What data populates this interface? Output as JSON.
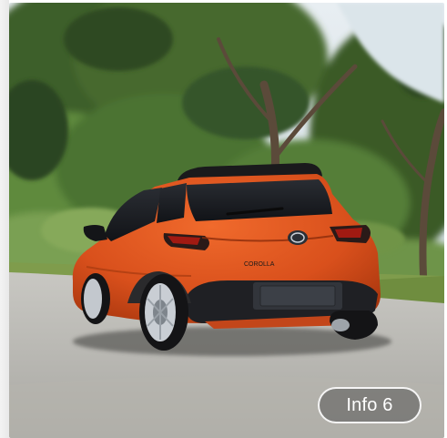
{
  "scene": {
    "subject": "car-photo",
    "badge_text": "COROLLA",
    "colors": {
      "sky": "#dfe8ee",
      "foliage_dark": "#2f4a22",
      "foliage_mid": "#4f7a36",
      "foliage_light": "#86a95a",
      "road": "#b9b8b4",
      "grass": "#7f9c4c",
      "car_body": "#e0531c",
      "car_shadow": "#9b2e0b",
      "glass": "#1b1d22"
    }
  },
  "info_button": {
    "label": "Info 6"
  }
}
